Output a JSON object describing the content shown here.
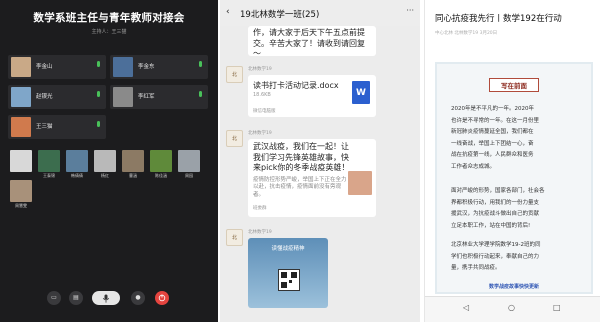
{
  "meeting": {
    "title": "数学系班主任与青年教师对接会",
    "subtitle": "主持人：王三猫",
    "participants": [
      {
        "name": "李金山",
        "color": "#c9a987",
        "mic": true
      },
      {
        "name": "李金东",
        "color": "#4c6f9a",
        "mic": true
      },
      {
        "name": "赵锲光",
        "color": "#7fa6c9",
        "mic": true
      },
      {
        "name": "李红军",
        "color": "#8a8a8a",
        "mic": true
      },
      {
        "name": "王三猫",
        "color": "#d07a4d",
        "mic": true
      }
    ],
    "thumbnails": [
      {
        "label": "",
        "color": "#d8d8d8"
      },
      {
        "label": "王泰锦",
        "color": "#3c6d4e"
      },
      {
        "label": "韩倩倩",
        "color": "#5b7e9c"
      },
      {
        "label": "杨红",
        "color": "#b9b9b9"
      },
      {
        "label": "曹涵",
        "color": "#8c7a64"
      },
      {
        "label": "陈佳涵",
        "color": "#5f8a3a"
      },
      {
        "label": "周园",
        "color": "#9aa1a8"
      },
      {
        "label": "周慧雯",
        "color": "#a8917a"
      }
    ],
    "controls": {
      "mic_icon": "mic-icon",
      "hangup_icon": "hangup-icon"
    }
  },
  "chat": {
    "title": "19北林数学一班(25)",
    "messages": [
      {
        "sender": "",
        "text": "作，请大家于后天下午五点前提交。辛苦大家了！请收到请回复～"
      },
      {
        "sender": "北林数学19",
        "file_name": "读书打卡活动记录.docx",
        "file_size": "18.6KB",
        "file_source": "微信电脑版"
      },
      {
        "sender": "北林数学19",
        "text": "武汉战疫，我们在一起！让我们学习先锋英雄故事，快来pick你的冬季战疫英雄！",
        "sub": "疫情防控形势严峻，举国上下正在全力以赴，抗击疫情，疫情面前没有旁观者。",
        "foot": "班委群"
      },
      {
        "sender": "北林数学19",
        "card_caption": "读懂战疫精神"
      }
    ]
  },
  "article": {
    "title": "同心抗疫我先行丨数学192在行动",
    "meta": "中心北林 北林数学19 3月20日",
    "badge": "写在前面",
    "paragraphs": [
      [
        "2020年是不平凡的一年。2020年",
        "也许是不寻常的一年。在这一月份里",
        "新冠肺炎疫情蔓延全国，我们都在",
        "一线奋战，举国上下团结一心，奋",
        "战在抗疫第一线，人民群众和医务",
        "工作者众志成城。"
      ],
      [
        "面对严峻的形势，国家各部门，社会各",
        "界都积极行动，用我们的一份力量支",
        "援武汉，为抗疫战斗做出自己的贡献",
        "立足本职工作，站在中国的背后!"
      ],
      [
        "北京林业大学理学院数学19-2班的同",
        "学们也积极行动起来，奉献自己的力",
        "量，携手共同战疫。"
      ]
    ],
    "link": "数学战疫故事快快更新"
  }
}
